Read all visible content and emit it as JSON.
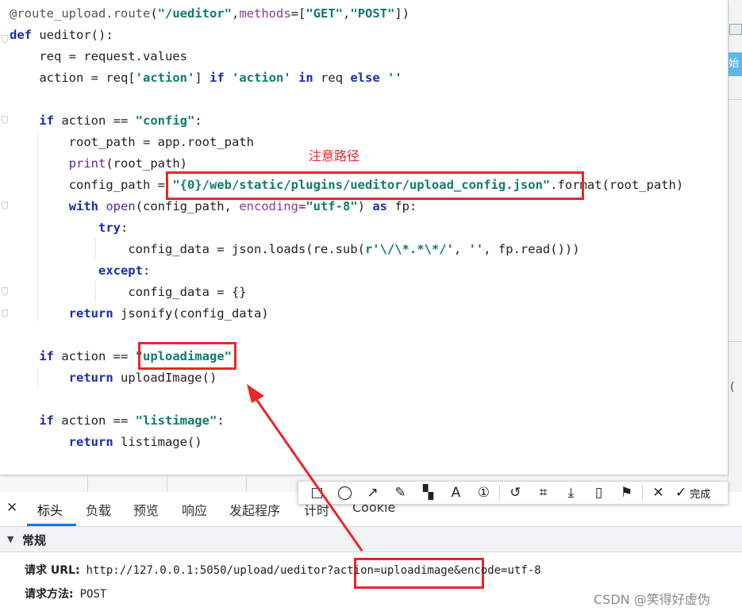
{
  "code": {
    "lines": [
      {
        "indent": 0,
        "tokens": [
          {
            "t": "@route_upload.",
            "c": "dec"
          },
          {
            "t": "route",
            "c": "dec"
          },
          {
            "t": "(",
            "c": ""
          },
          {
            "t": "\"/ueditor\"",
            "c": "str"
          },
          {
            "t": ",",
            "c": ""
          },
          {
            "t": "methods",
            "c": "prm"
          },
          {
            "t": "=[",
            "c": ""
          },
          {
            "t": "\"GET\"",
            "c": "str"
          },
          {
            "t": ",",
            "c": ""
          },
          {
            "t": "\"POST\"",
            "c": "str"
          },
          {
            "t": "])",
            "c": ""
          }
        ]
      },
      {
        "indent": 0,
        "tokens": [
          {
            "t": "def",
            "c": "kw"
          },
          {
            "t": " ueditor():",
            "c": ""
          }
        ]
      },
      {
        "indent": 1,
        "tokens": [
          {
            "t": "req = request.values",
            "c": ""
          }
        ]
      },
      {
        "indent": 1,
        "tokens": [
          {
            "t": "action = req[",
            "c": ""
          },
          {
            "t": "'action'",
            "c": "str"
          },
          {
            "t": "] ",
            "c": ""
          },
          {
            "t": "if",
            "c": "kw"
          },
          {
            "t": " ",
            "c": ""
          },
          {
            "t": "'action'",
            "c": "str"
          },
          {
            "t": " ",
            "c": ""
          },
          {
            "t": "in",
            "c": "kw"
          },
          {
            "t": " req ",
            "c": ""
          },
          {
            "t": "else",
            "c": "kw"
          },
          {
            "t": " ",
            "c": ""
          },
          {
            "t": "''",
            "c": "str"
          }
        ]
      },
      {
        "indent": 0,
        "tokens": []
      },
      {
        "indent": 1,
        "tokens": [
          {
            "t": "if",
            "c": "kw"
          },
          {
            "t": " action == ",
            "c": ""
          },
          {
            "t": "\"config\"",
            "c": "str"
          },
          {
            "t": ":",
            "c": ""
          }
        ]
      },
      {
        "indent": 2,
        "tokens": [
          {
            "t": "root_path = app.root_path",
            "c": ""
          }
        ]
      },
      {
        "indent": 2,
        "tokens": [
          {
            "t": "print",
            "c": "bi"
          },
          {
            "t": "(root_path)",
            "c": ""
          }
        ]
      },
      {
        "indent": 2,
        "tokens": [
          {
            "t": "config_path = ",
            "c": ""
          },
          {
            "t": "\"{0}/web/static/plugins/ueditor/upload_config.json\"",
            "c": "str"
          },
          {
            "t": ".format(root_path)",
            "c": ""
          }
        ]
      },
      {
        "indent": 2,
        "tokens": [
          {
            "t": "with",
            "c": "kw"
          },
          {
            "t": " ",
            "c": ""
          },
          {
            "t": "open",
            "c": "bi"
          },
          {
            "t": "(config_path, ",
            "c": ""
          },
          {
            "t": "encoding",
            "c": "prm"
          },
          {
            "t": "=",
            "c": ""
          },
          {
            "t": "\"utf-8\"",
            "c": "str"
          },
          {
            "t": ") ",
            "c": ""
          },
          {
            "t": "as",
            "c": "kw"
          },
          {
            "t": " fp:",
            "c": ""
          }
        ]
      },
      {
        "indent": 3,
        "tokens": [
          {
            "t": "try",
            "c": "kw"
          },
          {
            "t": ":",
            "c": ""
          }
        ]
      },
      {
        "indent": 4,
        "tokens": [
          {
            "t": "config_data = json.loads(re.sub(",
            "c": ""
          },
          {
            "t": "r'\\/\\*.*\\*/'",
            "c": "str"
          },
          {
            "t": ", ",
            "c": ""
          },
          {
            "t": "''",
            "c": "str"
          },
          {
            "t": ", fp.read()))",
            "c": ""
          }
        ]
      },
      {
        "indent": 3,
        "tokens": [
          {
            "t": "except",
            "c": "kw"
          },
          {
            "t": ":",
            "c": ""
          }
        ]
      },
      {
        "indent": 4,
        "tokens": [
          {
            "t": "config_data = {}",
            "c": ""
          }
        ]
      },
      {
        "indent": 2,
        "tokens": [
          {
            "t": "return",
            "c": "kw"
          },
          {
            "t": " jsonify(config_data)",
            "c": ""
          }
        ]
      },
      {
        "indent": 0,
        "tokens": []
      },
      {
        "indent": 1,
        "tokens": [
          {
            "t": "if",
            "c": "kw"
          },
          {
            "t": " action == ",
            "c": ""
          },
          {
            "t": "\"uploadimage\"",
            "c": "str"
          },
          {
            "t": ":",
            "c": ""
          }
        ]
      },
      {
        "indent": 2,
        "tokens": [
          {
            "t": "return",
            "c": "kw"
          },
          {
            "t": " uploadImage()",
            "c": ""
          }
        ]
      },
      {
        "indent": 0,
        "tokens": []
      },
      {
        "indent": 1,
        "tokens": [
          {
            "t": "if",
            "c": "kw"
          },
          {
            "t": " action == ",
            "c": ""
          },
          {
            "t": "\"listimage\"",
            "c": "str"
          },
          {
            "t": ":",
            "c": ""
          }
        ]
      },
      {
        "indent": 2,
        "tokens": [
          {
            "t": "return",
            "c": "kw"
          },
          {
            "t": " listimage()",
            "c": ""
          }
        ]
      }
    ]
  },
  "annotation": {
    "note": "注意路径"
  },
  "right_strip": {
    "blue_label": "始",
    "paren": "("
  },
  "snip_toolbar": {
    "tools": [
      {
        "name": "rectangle-tool-icon",
        "glyph": "□"
      },
      {
        "name": "ellipse-tool-icon",
        "glyph": "◯"
      },
      {
        "name": "arrow-tool-icon",
        "glyph": "↗"
      },
      {
        "name": "pen-tool-icon",
        "glyph": "✎"
      },
      {
        "name": "mosaic-tool-icon",
        "glyph": "▚"
      },
      {
        "name": "text-tool-icon",
        "glyph": "A"
      },
      {
        "name": "number-tool-icon",
        "glyph": "①"
      },
      {
        "sep": true
      },
      {
        "name": "undo-icon",
        "glyph": "↺"
      },
      {
        "name": "ocr-icon",
        "glyph": "⌗"
      },
      {
        "name": "download-icon",
        "glyph": "⤓"
      },
      {
        "name": "phone-icon",
        "glyph": "▯"
      },
      {
        "name": "pin-icon",
        "glyph": "⚑"
      },
      {
        "sep": true
      },
      {
        "name": "cancel-icon",
        "glyph": "✕"
      }
    ],
    "done_label": "完成",
    "done_glyph": "✓"
  },
  "devtools": {
    "close_glyph": "✕",
    "tabs": [
      {
        "label": "标头",
        "active": true
      },
      {
        "label": "负载",
        "active": false
      },
      {
        "label": "预览",
        "active": false
      },
      {
        "label": "响应",
        "active": false
      },
      {
        "label": "发起程序",
        "active": false
      },
      {
        "label": "计时",
        "active": false
      },
      {
        "label": "Cookie",
        "active": false
      }
    ],
    "section_title": "常规",
    "section_arrow": "▼",
    "request_url_label": "请求 URL:",
    "request_url_value": "http://127.0.0.1:5050/upload/ueditor?action=uploadimage&encode=utf-8",
    "request_method_label": "请求方法:",
    "request_method_value": "POST"
  },
  "watermark": "CSDN @笑得好虚伪",
  "colors": {
    "annotation_red": "#e8262b",
    "keyword": "#1a2ea8",
    "string": "#0f7b6c",
    "tab_accent": "#1a73e8"
  }
}
